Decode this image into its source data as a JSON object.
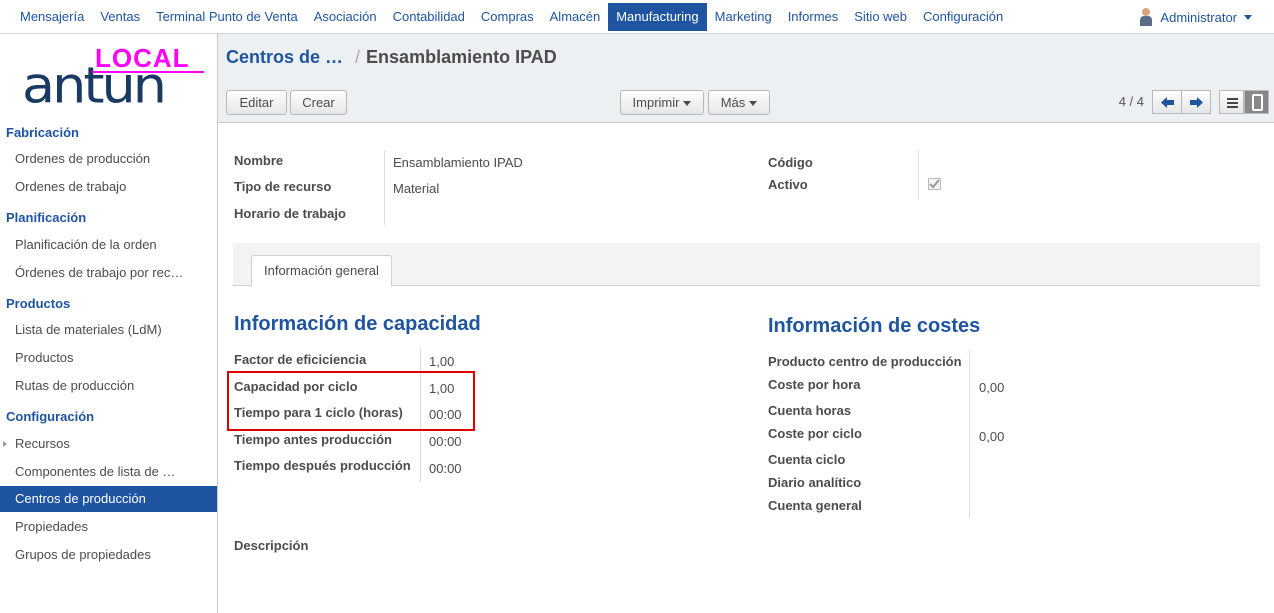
{
  "topmenu": {
    "items": [
      "Mensajería",
      "Ventas",
      "Terminal Punto de Venta",
      "Asociación",
      "Contabilidad",
      "Compras",
      "Almacén",
      "Manufacturing",
      "Marketing",
      "Informes",
      "Sitio web",
      "Configuración"
    ],
    "active": "Manufacturing",
    "user": "Administrator"
  },
  "logo": {
    "badge": "LOCAL",
    "brand": "antun"
  },
  "sidebar": {
    "sections": [
      {
        "title": "Fabricación",
        "items": [
          "Ordenes de producción",
          "Ordenes de trabajo"
        ]
      },
      {
        "title": "Planificación",
        "items": [
          "Planificación de la orden",
          "Órdenes de trabajo por rec…"
        ]
      },
      {
        "title": "Productos",
        "items": [
          "Lista de materiales (LdM)",
          "Productos",
          "Rutas de producción"
        ]
      },
      {
        "title": "Configuración",
        "items": [
          "Recursos",
          "Componentes de lista de …",
          "Centros de producción",
          "Propiedades",
          "Grupos de propiedades"
        ]
      }
    ],
    "active_item": "Centros de producción"
  },
  "breadcrumb": {
    "parent": "Centros de …",
    "separator": "/",
    "current": "Ensamblamiento IPAD"
  },
  "toolbar": {
    "edit": "Editar",
    "create": "Crear",
    "print": "Imprimir",
    "more": "Más",
    "pager": "4 / 4"
  },
  "form": {
    "left_fields": [
      {
        "label": "Nombre",
        "value": "Ensamblamiento IPAD"
      },
      {
        "label": "Tipo de recurso",
        "value": "Material"
      },
      {
        "label": "Horario de trabajo",
        "value": ""
      }
    ],
    "right_fields": [
      {
        "label": "Código",
        "value": ""
      },
      {
        "label": "Activo",
        "value": "checked"
      }
    ],
    "tab": "Información general",
    "capacity": {
      "title": "Información de capacidad",
      "rows": [
        {
          "label": "Factor de eficiciencia",
          "value": "1,00"
        },
        {
          "label": "Capacidad por ciclo",
          "value": "1,00"
        },
        {
          "label": "Tiempo para 1 ciclo (horas)",
          "value": "00:00"
        },
        {
          "label": "Tiempo antes producción",
          "value": "00:00"
        },
        {
          "label": "Tiempo después producción",
          "value": "00:00"
        }
      ]
    },
    "costs": {
      "title": "Información de costes",
      "rows": [
        {
          "label": "Producto centro de producción",
          "value": ""
        },
        {
          "label": "Coste por hora",
          "value": "0,00"
        },
        {
          "label": "Cuenta horas",
          "value": ""
        },
        {
          "label": "Coste por ciclo",
          "value": "0,00"
        },
        {
          "label": "Cuenta ciclo",
          "value": ""
        },
        {
          "label": "Diario analítico",
          "value": ""
        },
        {
          "label": "Cuenta general",
          "value": ""
        }
      ]
    },
    "description_label": "Descripción"
  },
  "colors": {
    "accent": "#1f55a0",
    "highlight_box": "#e00000",
    "logo_badge": "#ff00ff"
  }
}
